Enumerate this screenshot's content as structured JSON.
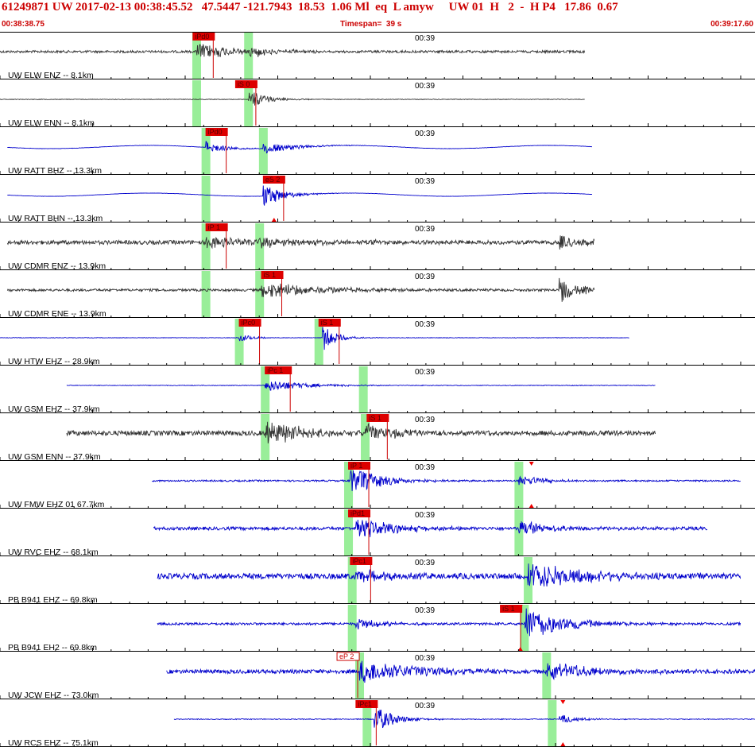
{
  "header": {
    "event_line": "61249871 UW 2017-02-13 00:38:45.52   47.5447 -121.7943  18.53  1.06 Ml  eq  L amyw     UW 01  H   2  -  H P4   17.86  0.67",
    "start_time": "00:38:38.75",
    "timespan": "Timespan=  39 s",
    "end_time": "00:39:17.60"
  },
  "colors": {
    "header_text": "#cc0000",
    "trace_black": "#333333",
    "trace_blue": "#0000cc",
    "pick_fill": "#dd0000",
    "pick_line": "#cc0000",
    "window": "#99ee99",
    "tick": "#000000",
    "flag": "#ee0000"
  },
  "time_label": "00:39",
  "traces": [
    {
      "label": "UW ELW ENZ -- 8.1km",
      "color": "black",
      "t_start": 0.0,
      "t_end": 31.6,
      "amp": 5,
      "picks": [
        {
          "label": "iPd0",
          "t": 10.4,
          "style": "filled"
        }
      ],
      "windows": [
        10.6,
        13.4
      ],
      "noise": 3,
      "bursts": [
        [
          10.6,
          6,
          11
        ],
        [
          13.4,
          4,
          6
        ]
      ]
    },
    {
      "label": "UW ELW ENN -- 8.1km",
      "color": "black",
      "t_start": 0.0,
      "t_end": 31.6,
      "amp": 1,
      "picks": [
        {
          "label": "iS 0",
          "t": 12.7,
          "style": "filled"
        }
      ],
      "windows": [
        10.6,
        13.4
      ],
      "noise": 0.8,
      "bursts": [
        [
          13.4,
          3,
          12
        ]
      ]
    },
    {
      "label": "UW RATT BHZ -- 13.3km",
      "color": "blue",
      "t_start": 0.4,
      "t_end": 32.0,
      "amp": 3,
      "picks": [
        {
          "label": "iPd0",
          "t": 11.1,
          "style": "filled"
        }
      ],
      "windows": [
        11.1,
        14.2
      ],
      "noise": 0.4,
      "wave": 2,
      "bursts": [
        [
          11.1,
          3,
          8
        ],
        [
          14.2,
          5,
          7
        ]
      ]
    },
    {
      "label": "UW RATT BHN -- 13.3km",
      "color": "blue",
      "t_start": 0.4,
      "t_end": 32.0,
      "amp": 3,
      "picks": [
        {
          "label": "eS 2",
          "t": 14.2,
          "style": "filled"
        }
      ],
      "windows": [
        11.1
      ],
      "noise": 0.3,
      "wave": 2,
      "bursts": [
        [
          14.2,
          3,
          16
        ]
      ],
      "flag_t": 14.8
    },
    {
      "label": "UW CDMR ENZ -- 13.9km",
      "color": "black",
      "t_start": 0.4,
      "t_end": 32.1,
      "amp": 7,
      "picks": [
        {
          "label": "iP 1",
          "t": 11.1,
          "style": "filled"
        }
      ],
      "windows": [
        11.1,
        14.0
      ],
      "noise": 5,
      "bursts": [
        [
          11.1,
          12,
          6
        ],
        [
          14.0,
          10,
          5
        ],
        [
          30.2,
          4,
          9
        ]
      ]
    },
    {
      "label": "UW CDMR ENE -- 13.9km",
      "color": "black",
      "t_start": 0.4,
      "t_end": 32.1,
      "amp": 3,
      "picks": [
        {
          "label": "iS 1",
          "t": 14.1,
          "style": "filled"
        }
      ],
      "windows": [
        11.1,
        14.0
      ],
      "noise": 3,
      "bursts": [
        [
          14.1,
          10,
          10
        ],
        [
          30.2,
          3,
          16
        ]
      ]
    },
    {
      "label": "UW HTW EHZ -- 28.9km",
      "color": "blue",
      "t_start": 0.0,
      "t_end": 34.0,
      "amp": 3,
      "picks": [
        {
          "label": "iPc0",
          "t": 12.9,
          "style": "filled"
        },
        {
          "label": "iS 1",
          "t": 17.2,
          "style": "filled"
        }
      ],
      "windows": [
        12.9,
        17.2
      ],
      "noise": 0.6,
      "bursts": [
        [
          12.9,
          2,
          5
        ],
        [
          17.4,
          2,
          18
        ]
      ]
    },
    {
      "label": "UW GSM EHZ -- 37.9km",
      "color": "blue",
      "t_start": 3.6,
      "t_end": 35.4,
      "amp": 3,
      "picks": [
        {
          "label": "iPc 1",
          "t": 14.3,
          "style": "filled"
        }
      ],
      "windows": [
        14.3,
        19.6
      ],
      "noise": 0.8,
      "bursts": [
        [
          14.3,
          6,
          8
        ]
      ]
    },
    {
      "label": "UW GSM ENN -- 37.9km",
      "color": "black",
      "t_start": 3.6,
      "t_end": 35.4,
      "amp": 3,
      "picks": [
        {
          "label": "iS 1",
          "t": 19.8,
          "style": "filled"
        }
      ],
      "windows": [
        14.3,
        19.7
      ],
      "noise": 6,
      "bursts": [
        [
          14.3,
          6,
          16
        ],
        [
          19.7,
          5,
          11
        ]
      ]
    },
    {
      "label": "UW FMW EHZ 01 67.7km",
      "color": "blue",
      "t_start": 8.2,
      "t_end": 40.0,
      "amp": 4,
      "picks": [
        {
          "label": "iP 1",
          "t": 18.8,
          "style": "filled"
        }
      ],
      "windows": [
        18.8,
        28.0
      ],
      "noise": 2,
      "bursts": [
        [
          18.9,
          5,
          18
        ],
        [
          28.0,
          4,
          7
        ]
      ],
      "flag_t": 28.7
    },
    {
      "label": "UW RVC EHZ -- 68.1km",
      "color": "blue",
      "t_start": 8.3,
      "t_end": 38.2,
      "amp": 4,
      "picks": [
        {
          "label": "iPd1",
          "t": 18.8,
          "style": "filled"
        }
      ],
      "windows": [
        18.8,
        28.0
      ],
      "noise": 4,
      "bursts": [
        [
          19.2,
          6,
          14
        ],
        [
          28.0,
          6,
          9
        ]
      ]
    },
    {
      "label": "PB B941 EHZ -- 69.8km",
      "color": "blue",
      "t_start": 8.5,
      "t_end": 40.0,
      "amp": 5,
      "picks": [
        {
          "label": "iPc1",
          "t": 18.9,
          "style": "filled"
        }
      ],
      "windows": [
        19.0,
        28.5
      ],
      "noise": 7,
      "bursts": [
        [
          19.2,
          6,
          8
        ],
        [
          28.5,
          8,
          18
        ]
      ]
    },
    {
      "label": "PB B941 EH2 -- 69.8km",
      "color": "blue",
      "t_start": 8.5,
      "t_end": 40.0,
      "amp": 5,
      "picks": [
        {
          "label": "iS 1",
          "t": 27.0,
          "style": "filled"
        }
      ],
      "windows": [
        19.0,
        28.3
      ],
      "noise": 3,
      "bursts": [
        [
          19.2,
          4,
          7
        ],
        [
          28.3,
          6,
          22
        ]
      ],
      "flag_t": 28.1
    },
    {
      "label": "UW JCW EHZ -- 73.0km",
      "color": "blue",
      "t_start": 9.0,
      "t_end": 40.8,
      "amp": 6,
      "picks": [
        {
          "label": "eP 2",
          "t": 18.2,
          "style": "outline"
        }
      ],
      "windows": [
        19.4,
        29.5
      ],
      "noise": 5,
      "bursts": [
        [
          19.4,
          10,
          14
        ],
        [
          29.5,
          8,
          12
        ]
      ]
    },
    {
      "label": "UW RCS EHZ -- 75.1km",
      "color": "blue",
      "t_start": 9.4,
      "t_end": 40.8,
      "amp": 3,
      "picks": [
        {
          "label": "iPc1",
          "t": 19.2,
          "style": "filled"
        }
      ],
      "windows": [
        19.8,
        29.8
      ],
      "noise": 1,
      "bursts": [
        [
          20.2,
          3,
          18
        ],
        [
          30.2,
          3,
          6
        ]
      ],
      "flag_t": 30.4
    }
  ]
}
